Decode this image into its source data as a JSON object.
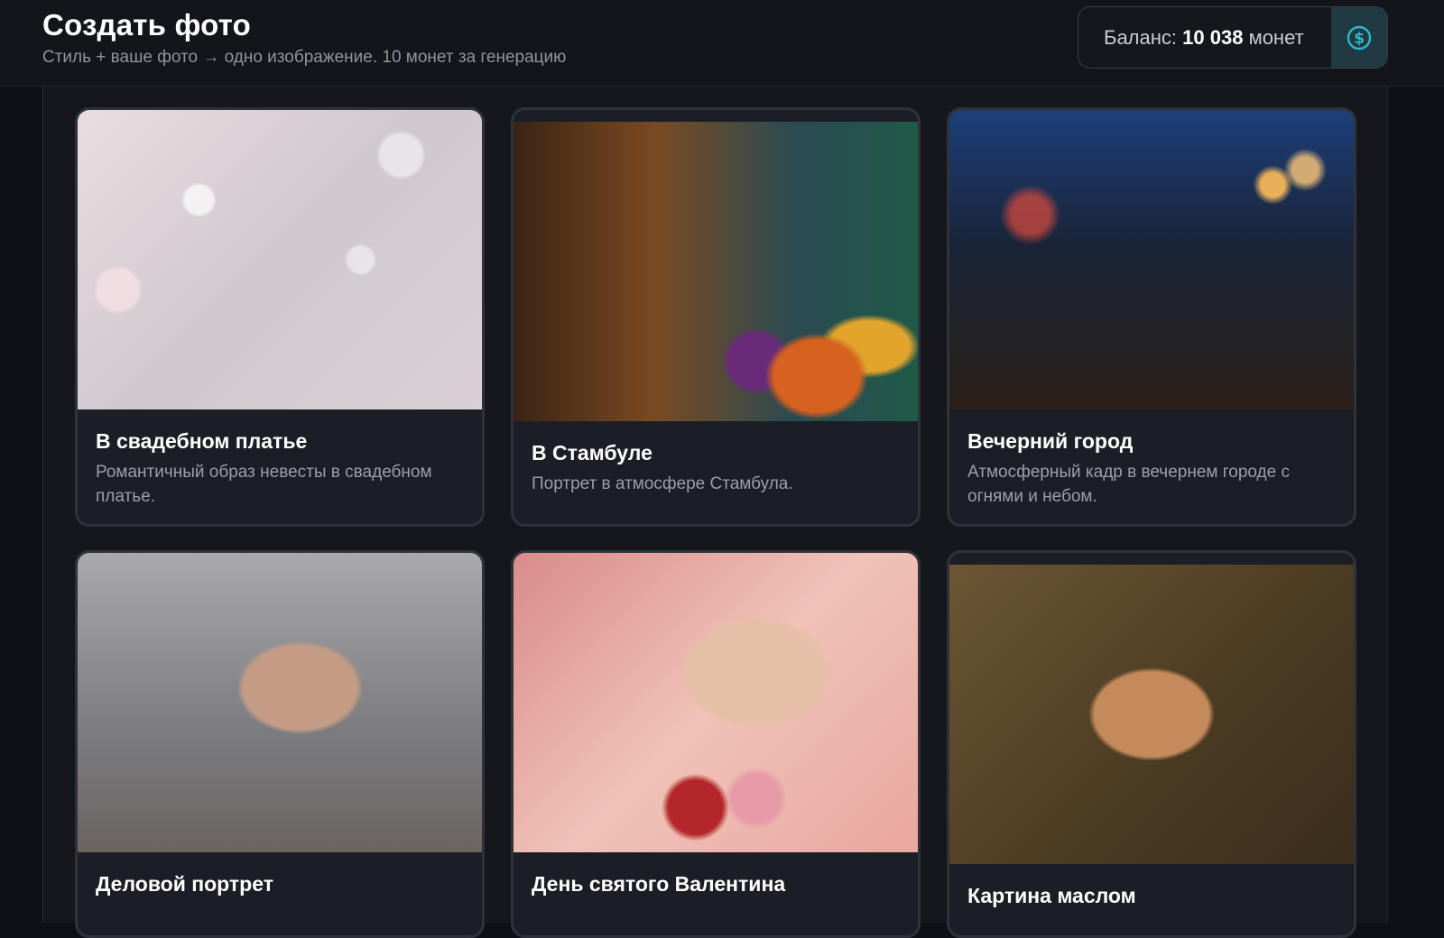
{
  "header": {
    "title": "Создать фото",
    "subtitle": "Стиль + ваше фото → одно изображение. 10 монет за генерацию"
  },
  "balance": {
    "label": "Баланс:",
    "amount": "10 038",
    "unit": "монет",
    "icon": "dollar-coin-icon",
    "accent": "#2fb7c8"
  },
  "styles": [
    {
      "title": "В свадебном платье",
      "description": "Романтичный образ невесты в свадебном платье.",
      "image": "bride-in-veil-photo"
    },
    {
      "title": "В Стамбуле",
      "description": "Портрет в атмосфере Стамбула.",
      "image": "woman-at-spice-bazaar-photo"
    },
    {
      "title": "Вечерний город",
      "description": "Атмосферный кадр в вечернем городе с огнями и небом.",
      "image": "man-on-night-street-photo"
    },
    {
      "title": "Деловой портрет",
      "description": "",
      "image": "business-headshot-photo"
    },
    {
      "title": "День святого Валентина",
      "description": "",
      "image": "couple-with-roses-photo"
    },
    {
      "title": "Картина маслом",
      "description": "",
      "image": "oil-painting-portrait"
    }
  ]
}
